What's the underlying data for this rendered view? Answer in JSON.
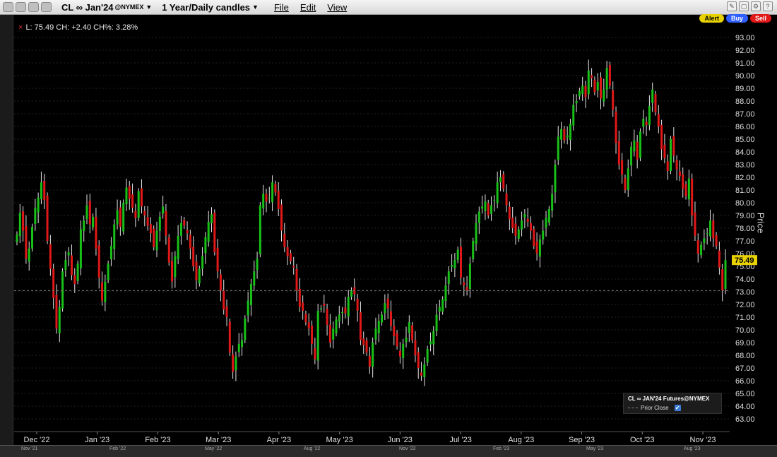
{
  "titlebar": {
    "symbol": "CL ∞ Jan'24",
    "exchange": "@NYMEX",
    "period": "1 Year/Daily candles",
    "menus": [
      "File",
      "Edit",
      "View"
    ]
  },
  "actions": {
    "alert": "Alert",
    "buy": "Buy",
    "sell": "Sell"
  },
  "info_line": "L: 75.49 CH: +2.40 CH%: 3.28%",
  "price_axis_title": "Price",
  "last_price_label": "75.49",
  "legend": {
    "title": "CL ∞ JAN'24 Futures@NYMEX",
    "prior_close": "Prior Close",
    "check": "✔"
  },
  "nav_strip": {
    "labels": [
      "Nov '21",
      "Feb '22",
      "May '22",
      "Aug '22",
      "Nov '22",
      "Feb '23",
      "May '23",
      "Aug '23"
    ]
  },
  "colors": {
    "up": "#18c018",
    "down": "#e01818",
    "wick": "#e6e6e6",
    "grid": "#222222",
    "axis_text": "#e0e0e0"
  },
  "chart_data": {
    "type": "candlestick",
    "ylim": [
      62,
      94
    ],
    "prior_close": 73.09,
    "last": 75.49,
    "yticks": [
      63,
      64,
      65,
      66,
      67,
      68,
      69,
      70,
      71,
      72,
      73,
      74,
      75,
      76,
      77,
      78,
      79,
      80,
      81,
      82,
      83,
      84,
      85,
      86,
      87,
      88,
      89,
      90,
      91,
      92,
      93
    ],
    "x_tick_labels": [
      "Dec '22",
      "Jan '23",
      "Feb '23",
      "Mar '23",
      "Apr '23",
      "May '23",
      "Jun '23",
      "Jul '23",
      "Aug '23",
      "Sep '23",
      "Oct '23",
      "Nov '23"
    ],
    "closes": [
      77.5,
      79.2,
      77.8,
      75.6,
      76.4,
      78.1,
      79.6,
      80.4,
      81.6,
      80.2,
      77.0,
      74.8,
      72.5,
      70.1,
      71.8,
      74.6,
      75.5,
      76.1,
      74.3,
      73.6,
      75.2,
      77.9,
      78.6,
      79.8,
      78.3,
      78.9,
      76.4,
      74.1,
      72.3,
      73.8,
      75.2,
      76.6,
      78.3,
      79.4,
      78.1,
      80.0,
      81.2,
      80.3,
      79.6,
      78.8,
      80.9,
      79.7,
      79.0,
      78.2,
      77.6,
      76.5,
      77.8,
      78.9,
      79.7,
      77.4,
      75.3,
      73.8,
      75.8,
      77.4,
      78.4,
      78.2,
      77.6,
      76.4,
      75.0,
      73.9,
      74.8,
      75.8,
      77.3,
      78.5,
      79.1,
      76.1,
      74.6,
      73.1,
      71.6,
      71.0,
      68.2,
      66.7,
      67.9,
      68.9,
      69.2,
      70.9,
      72.3,
      73.6,
      74.6,
      75.6,
      79.8,
      80.7,
      80.1,
      80.4,
      81.6,
      80.8,
      79.5,
      77.8,
      76.5,
      75.8,
      75.4,
      74.9,
      73.1,
      71.8,
      71.5,
      70.6,
      70.1,
      68.9,
      67.7,
      71.5,
      71.7,
      71.9,
      70.4,
      69.0,
      70.1,
      70.8,
      71.2,
      71.4,
      71.3,
      72.6,
      73.1,
      72.8,
      71.5,
      69.2,
      68.8,
      68.2,
      67.1,
      69.0,
      70.1,
      70.7,
      71.2,
      72.1,
      71.7,
      70.3,
      69.5,
      68.7,
      67.9,
      68.9,
      69.4,
      70.6,
      69.2,
      68.0,
      67.0,
      66.4,
      67.3,
      68.5,
      69.1,
      69.9,
      71.2,
      71.8,
      72.4,
      73.5,
      74.6,
      75.1,
      75.5,
      76.3,
      74.1,
      73.5,
      73.1,
      75.2,
      77.0,
      78.4,
      79.3,
      79.7,
      80.1,
      79.0,
      79.8,
      80.2,
      81.6,
      82.0,
      81.1,
      79.8,
      78.7,
      78.0,
      77.4,
      77.9,
      78.6,
      79.1,
      78.5,
      77.8,
      76.6,
      76.0,
      77.1,
      77.8,
      78.8,
      79.5,
      80.7,
      83.0,
      85.2,
      85.8,
      84.9,
      85.3,
      86.2,
      87.7,
      88.0,
      88.8,
      89.2,
      88.3,
      90.4,
      89.8,
      88.7,
      89.5,
      88.2,
      88.9,
      90.6,
      89.2,
      87.3,
      84.7,
      83.0,
      82.2,
      81.0,
      82.7,
      84.4,
      84.9,
      83.4,
      85.6,
      86.6,
      86.1,
      87.6,
      88.9,
      87.1,
      86.0,
      84.2,
      83.5,
      82.5,
      85.0,
      83.7,
      82.6,
      82.1,
      81.1,
      80.5,
      81.9,
      79.0,
      77.4,
      76.0,
      76.7,
      77.2,
      77.6,
      78.6,
      77.2,
      76.6,
      74.9,
      73.1,
      75.49
    ]
  }
}
